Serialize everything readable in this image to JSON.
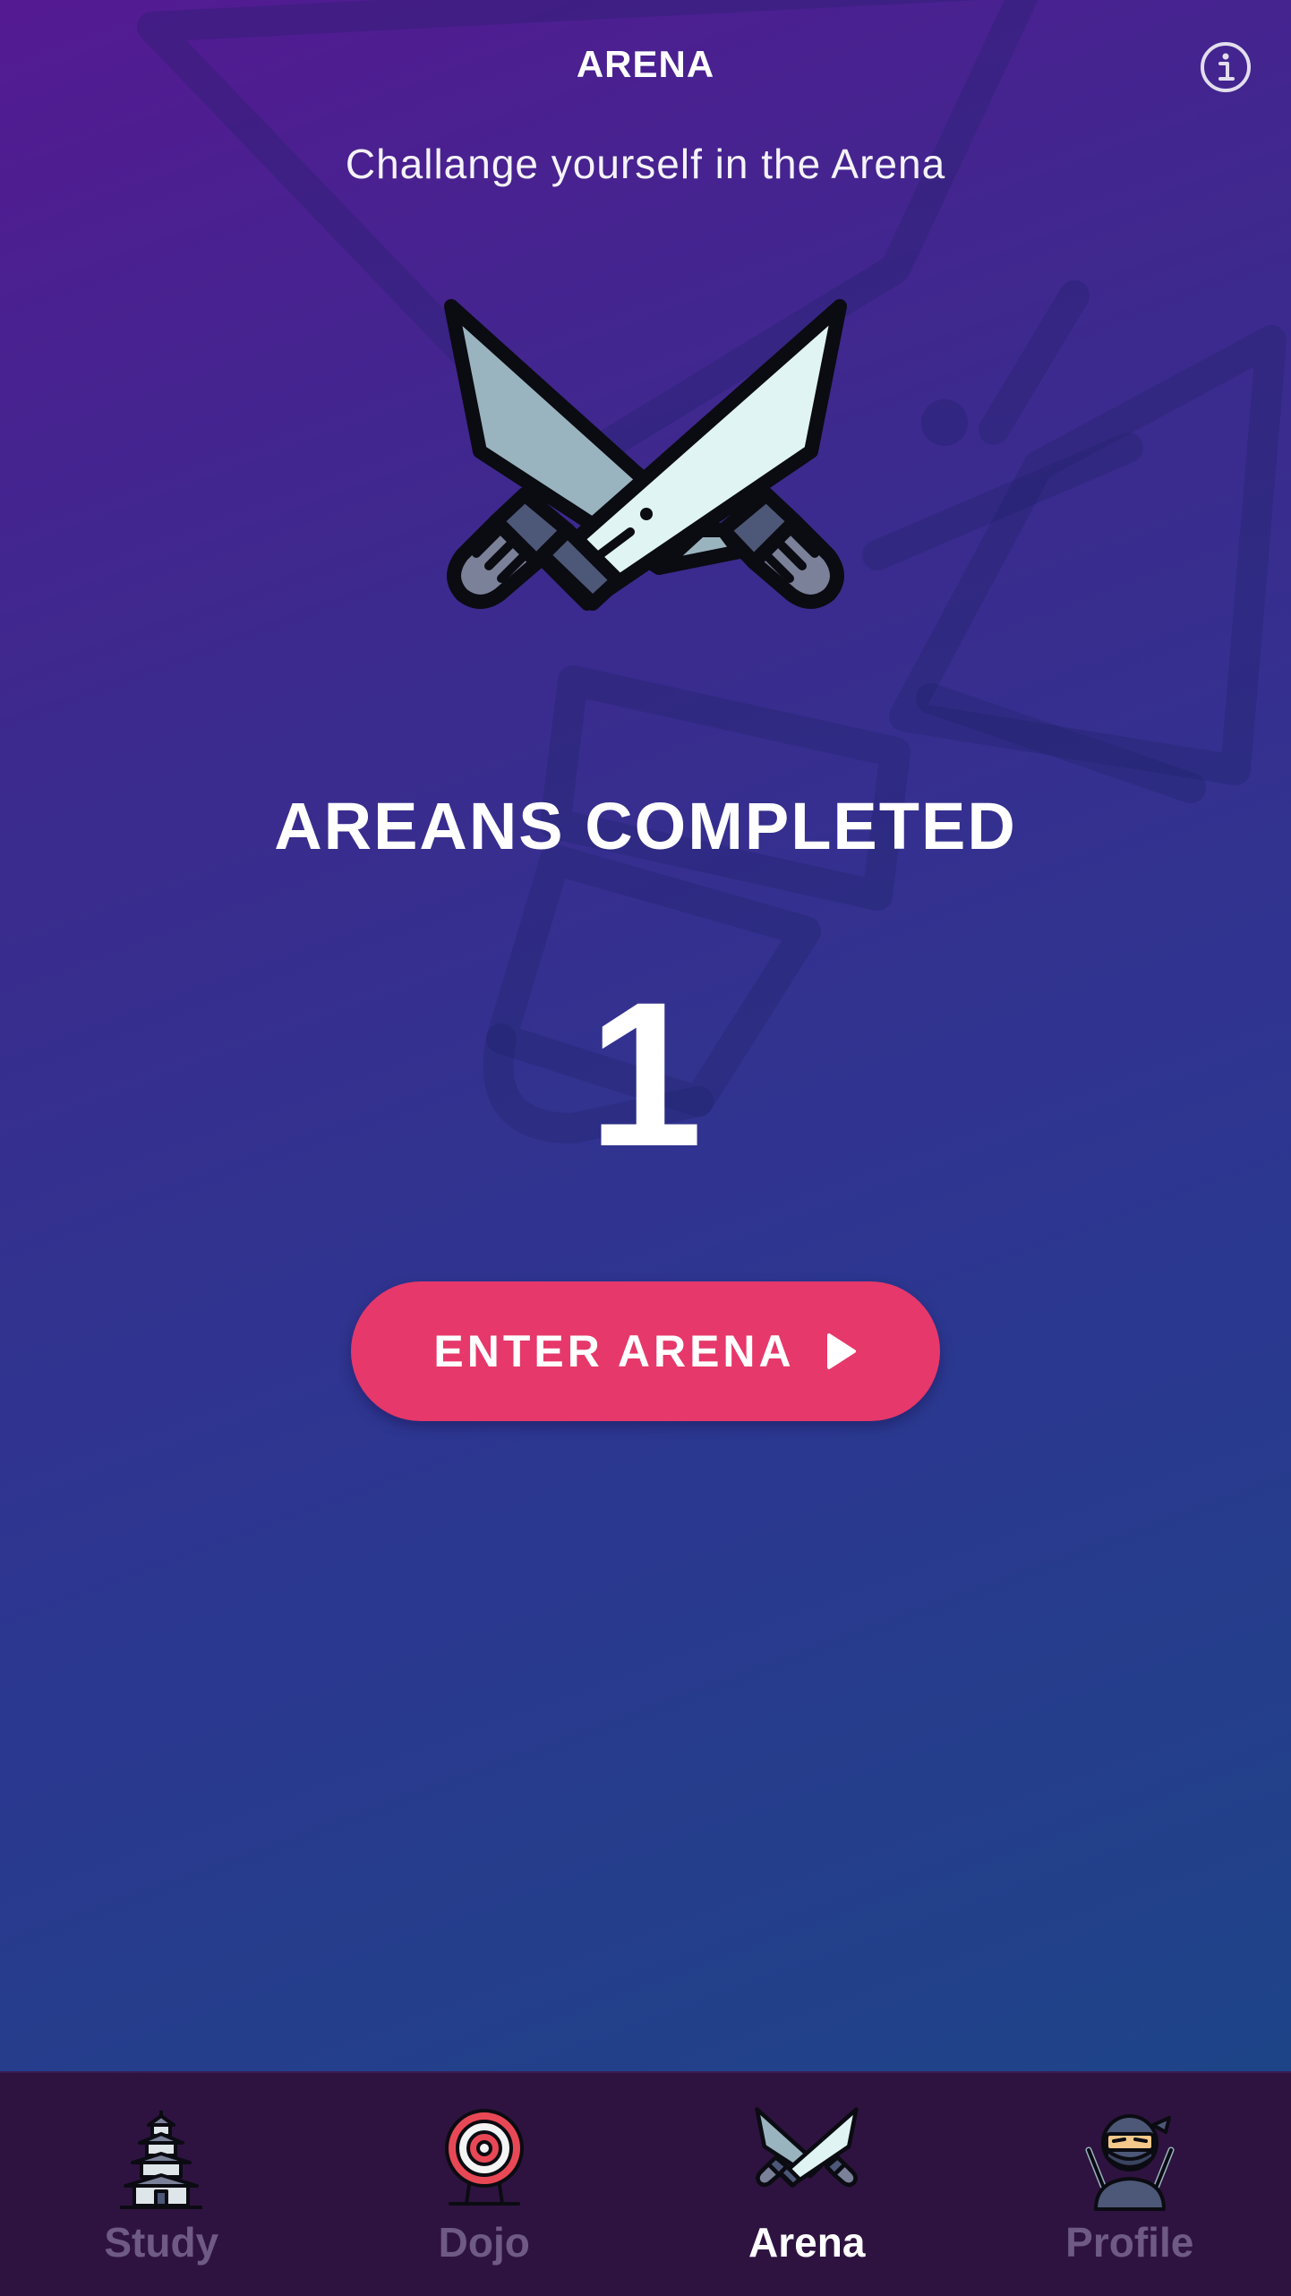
{
  "header": {
    "title": "ARENA",
    "info_icon": "info-circle-icon",
    "subtitle": "Challange yourself in the Arena"
  },
  "hero": {
    "icon": "crossed-swords-icon"
  },
  "stats": {
    "label": "AREANS COMPLETED",
    "count": "1"
  },
  "cta": {
    "label": "ENTER ARENA",
    "icon": "play-triangle-icon",
    "color": "#e6386a"
  },
  "tabs": [
    {
      "label": "Study",
      "icon": "pagoda-icon",
      "active": false
    },
    {
      "label": "Dojo",
      "icon": "target-icon",
      "active": false
    },
    {
      "label": "Arena",
      "icon": "crossed-swords-icon",
      "active": true
    },
    {
      "label": "Profile",
      "icon": "ninja-avatar-icon",
      "active": false
    }
  ],
  "colors": {
    "background_top": "#541a92",
    "background_bottom": "#1e4488",
    "tabbar": "#2e1340",
    "tab_inactive": "#6f5a86",
    "tab_active": "#ffffff"
  }
}
